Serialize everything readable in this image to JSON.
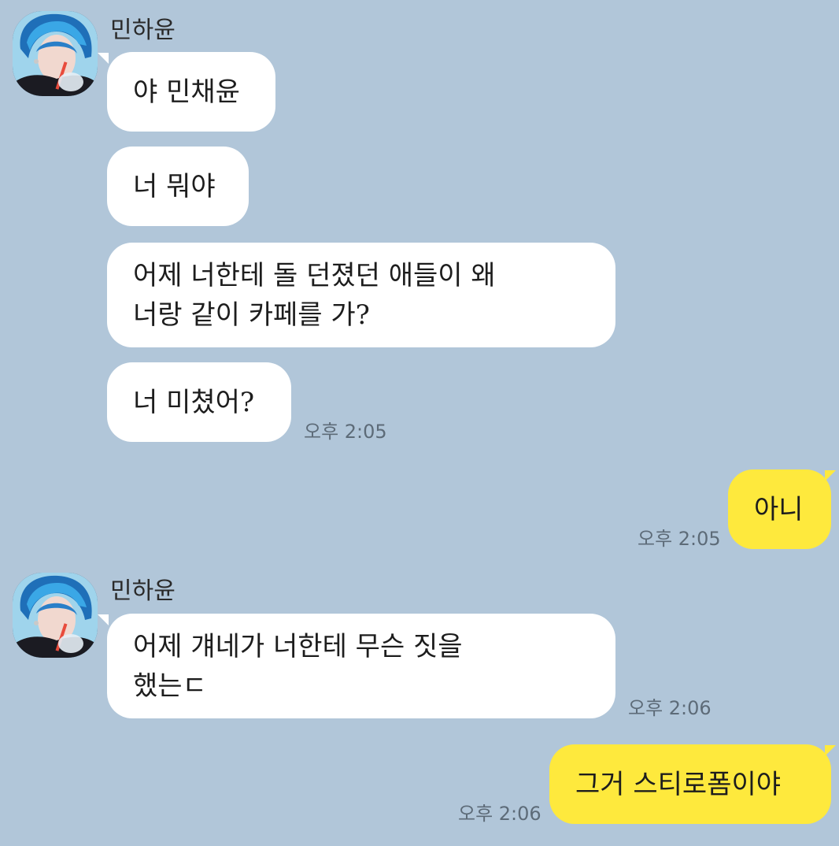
{
  "sender": {
    "name": "민하윤",
    "avatar": "profile-photo"
  },
  "colors": {
    "background": "#b1c6d9",
    "incoming_bubble": "#ffffff",
    "outgoing_bubble": "#fee93d",
    "timestamp": "#5d6b78"
  },
  "messages": [
    {
      "from": "other",
      "text": "야 민채윤"
    },
    {
      "from": "other",
      "text": "너 뭐야"
    },
    {
      "from": "other",
      "text": "어제 너한테 돌 던졌던 애들이 왜\n너랑 같이 카페를 가?"
    },
    {
      "from": "other",
      "text": "너 미쳤어?",
      "time": "오후 2:05"
    },
    {
      "from": "me",
      "text": "아니",
      "time": "오후 2:05"
    },
    {
      "from": "other",
      "text": "어제 걔네가 너한테 무슨 짓을\n했는ㄷ",
      "time": "오후 2:06"
    },
    {
      "from": "me",
      "text": "그거 스티로폼이야",
      "time": "오후 2:06"
    }
  ]
}
